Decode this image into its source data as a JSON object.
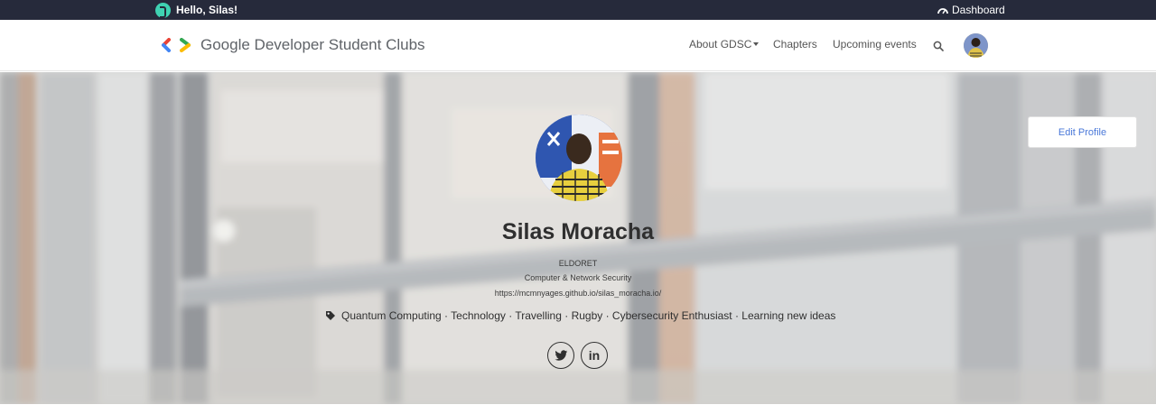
{
  "topbar": {
    "greeting": "Hello, Silas!",
    "dashboard_label": "Dashboard"
  },
  "nav": {
    "brand": "Google Developer Student Clubs",
    "links": [
      "About GDSC",
      "Chapters",
      "Upcoming events"
    ],
    "search_icon": "search-icon",
    "avatar": "user-avatar"
  },
  "profile": {
    "edit_label": "Edit Profile",
    "name": "Silas Moracha",
    "location": "ELDORET",
    "field": "Computer & Network Security",
    "website": "https://mcmnyages.github.io/silas_moracha.io/",
    "interests": "Quantum Computing · Technology · Travelling · Rugby · Cybersecurity Enthusiast · Learning new ideas",
    "social": [
      "twitter-icon",
      "linkedin-icon"
    ],
    "linkedin_glyph": "in"
  },
  "colors": {
    "topbar": "#262a3b",
    "accent": "#4a78d9",
    "badge": "#3fd2b2"
  }
}
